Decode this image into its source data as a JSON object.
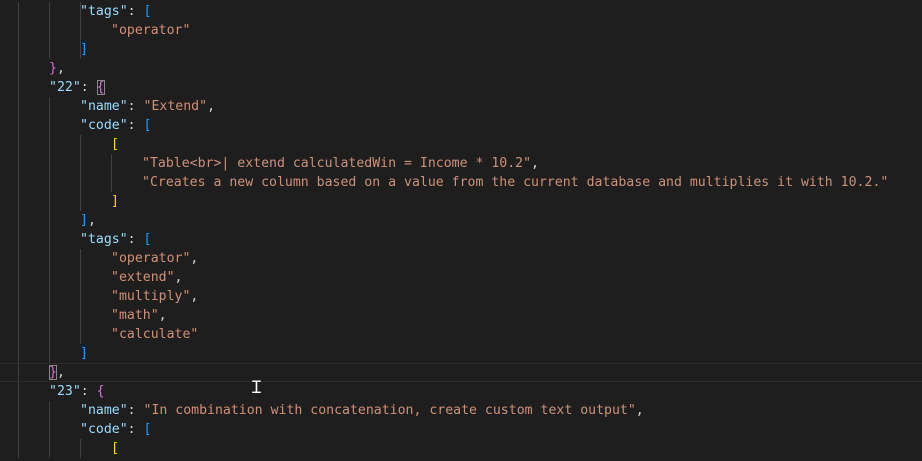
{
  "editor": {
    "lines": [
      {
        "tokens": [
          {
            "t": "key",
            "v": "\"tags\""
          },
          {
            "t": "pun",
            "v": ": "
          },
          {
            "t": "b2",
            "v": "["
          }
        ]
      },
      {
        "tokens": [
          {
            "t": "str",
            "v": "\"operator\""
          }
        ]
      },
      {
        "tokens": [
          {
            "t": "b2",
            "v": "]"
          }
        ]
      },
      {
        "tokens": [
          {
            "t": "b1",
            "v": "}"
          },
          {
            "t": "pun",
            "v": ","
          }
        ]
      },
      {
        "tokens": [
          {
            "t": "key",
            "v": "\"22\""
          },
          {
            "t": "pun",
            "v": ": "
          },
          {
            "t": "b1",
            "v": "{"
          }
        ]
      },
      {
        "tokens": [
          {
            "t": "key",
            "v": "\"name\""
          },
          {
            "t": "pun",
            "v": ": "
          },
          {
            "t": "str",
            "v": "\"Extend\""
          },
          {
            "t": "pun",
            "v": ","
          }
        ]
      },
      {
        "tokens": [
          {
            "t": "key",
            "v": "\"code\""
          },
          {
            "t": "pun",
            "v": ": "
          },
          {
            "t": "b2",
            "v": "["
          }
        ]
      },
      {
        "tokens": [
          {
            "t": "b3",
            "v": "["
          }
        ]
      },
      {
        "tokens": [
          {
            "t": "str",
            "v": "\"Table<br>| extend calculatedWin = Income * 10.2\""
          },
          {
            "t": "pun",
            "v": ","
          }
        ]
      },
      {
        "tokens": [
          {
            "t": "str",
            "v": "\"Creates a new column based on a value from the current database and multiplies it with 10.2.\""
          }
        ]
      },
      {
        "tokens": [
          {
            "t": "b3",
            "v": "]"
          }
        ]
      },
      {
        "tokens": [
          {
            "t": "b2",
            "v": "]"
          },
          {
            "t": "pun",
            "v": ","
          }
        ]
      },
      {
        "tokens": [
          {
            "t": "key",
            "v": "\"tags\""
          },
          {
            "t": "pun",
            "v": ": "
          },
          {
            "t": "b2",
            "v": "["
          }
        ]
      },
      {
        "tokens": [
          {
            "t": "str",
            "v": "\"operator\""
          },
          {
            "t": "pun",
            "v": ","
          }
        ]
      },
      {
        "tokens": [
          {
            "t": "str",
            "v": "\"extend\""
          },
          {
            "t": "pun",
            "v": ","
          }
        ]
      },
      {
        "tokens": [
          {
            "t": "str",
            "v": "\"multiply\""
          },
          {
            "t": "pun",
            "v": ","
          }
        ]
      },
      {
        "tokens": [
          {
            "t": "str",
            "v": "\"math\""
          },
          {
            "t": "pun",
            "v": ","
          }
        ]
      },
      {
        "tokens": [
          {
            "t": "str",
            "v": "\"calculate\""
          }
        ]
      },
      {
        "tokens": [
          {
            "t": "b2",
            "v": "]"
          }
        ]
      },
      {
        "tokens": [
          {
            "t": "b1",
            "v": "}"
          },
          {
            "t": "pun",
            "v": ","
          }
        ]
      },
      {
        "tokens": [
          {
            "t": "key",
            "v": "\"23\""
          },
          {
            "t": "pun",
            "v": ": "
          },
          {
            "t": "b1",
            "v": "{"
          }
        ]
      },
      {
        "tokens": [
          {
            "t": "key",
            "v": "\"name\""
          },
          {
            "t": "pun",
            "v": ": "
          },
          {
            "t": "str",
            "v": "\"In combination with concatenation, create custom text output\""
          },
          {
            "t": "pun",
            "v": ","
          }
        ]
      },
      {
        "tokens": [
          {
            "t": "key",
            "v": "\"code\""
          },
          {
            "t": "pun",
            "v": ": "
          },
          {
            "t": "b2",
            "v": "["
          }
        ]
      },
      {
        "tokens": [
          {
            "t": "b3",
            "v": "["
          }
        ]
      }
    ],
    "cursor_icon": "text-ibeam-cursor-icon",
    "colors": {
      "background": "#1e1e1e",
      "key": "#9cdcfe",
      "string": "#ce9178",
      "punctuation": "#d4d4d4",
      "bracket_level_1": "#da70d6",
      "bracket_level_2": "#179fff",
      "bracket_level_3": "#ffd700",
      "indent_guide": "#404040"
    }
  }
}
